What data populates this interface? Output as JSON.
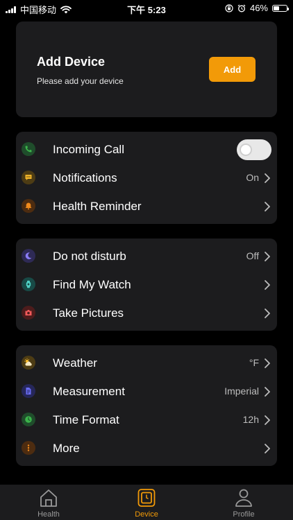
{
  "status_bar": {
    "carrier": "中国移动",
    "time": "下午 5:23",
    "battery_percent": "46%",
    "battery_level": 0.46
  },
  "add_device": {
    "title": "Add Device",
    "subtitle": "Please add your device",
    "button_label": "Add"
  },
  "group1": {
    "incoming_call": {
      "label": "Incoming Call",
      "toggle_on": false,
      "icon": "phone-icon",
      "icon_color": "#3cb44b"
    },
    "notifications": {
      "label": "Notifications",
      "value": "On",
      "icon": "message-icon",
      "icon_color": "#f0b429"
    },
    "health_reminder": {
      "label": "Health Reminder",
      "icon": "bell-icon",
      "icon_color": "#f08a1c"
    }
  },
  "group2": {
    "do_not_disturb": {
      "label": "Do not disturb",
      "value": "Off",
      "icon": "moon-icon",
      "icon_color": "#8a7cf6"
    },
    "find_my_watch": {
      "label": "Find My Watch",
      "icon": "watch-icon",
      "icon_color": "#4fd1c5"
    },
    "take_pictures": {
      "label": "Take Pictures",
      "icon": "camera-icon",
      "icon_color": "#f05a5a"
    }
  },
  "group3": {
    "weather": {
      "label": "Weather",
      "value": "°F",
      "icon": "weather-icon",
      "icon_color": "#f0b429"
    },
    "measurement": {
      "label": "Measurement",
      "value": "Imperial",
      "icon": "ruler-icon",
      "icon_color": "#6b6df5"
    },
    "time_format": {
      "label": "Time Format",
      "value": "12h",
      "icon": "clock-icon",
      "icon_color": "#3cb44b"
    },
    "more": {
      "label": "More",
      "icon": "more-icon",
      "icon_color": "#f08a1c"
    }
  },
  "tabbar": {
    "health": "Health",
    "device": "Device",
    "profile": "Profile",
    "active": "device",
    "active_color": "#f29a08"
  }
}
